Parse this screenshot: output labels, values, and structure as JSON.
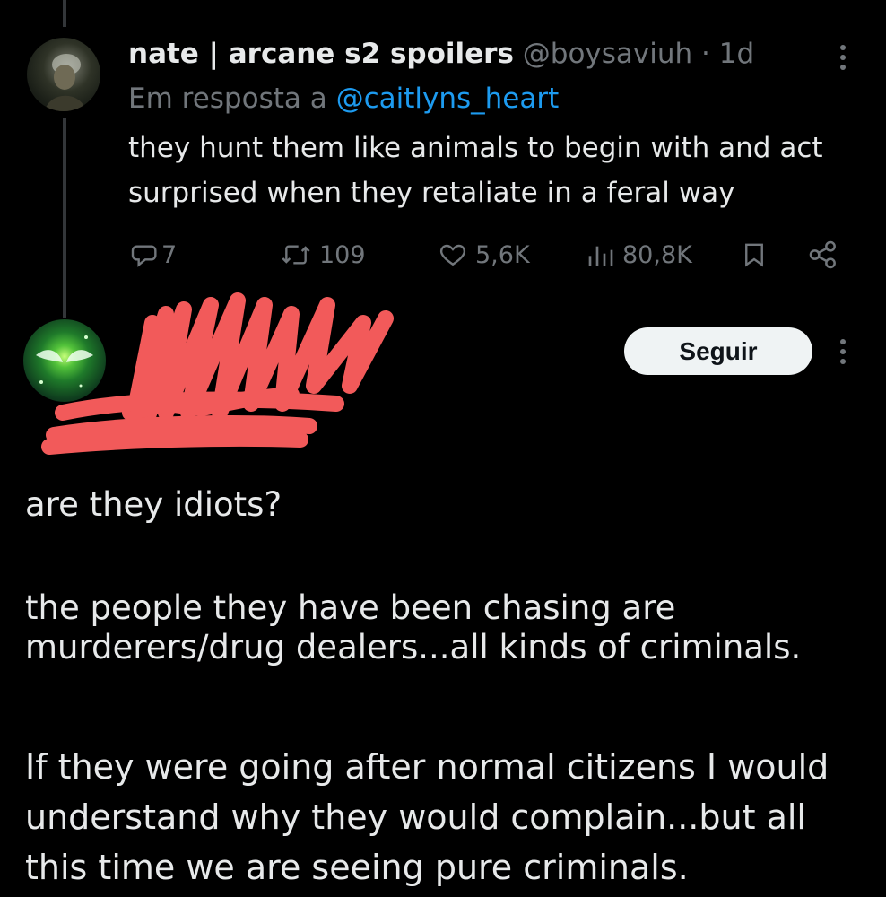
{
  "reply_tweet": {
    "display_name": "nate | arcane s2 spoilers",
    "handle": "@boysaviuh",
    "separator": " · ",
    "time": "1d",
    "reply_prefix": "Em resposta a ",
    "reply_to": "@caitlyns_heart",
    "text": "they hunt them like animals to begin with and act surprised when they retaliate in a feral way",
    "actions": {
      "replies": "7",
      "reposts": "109",
      "likes": "5,6K",
      "views": "80,8K"
    },
    "icons": [
      "reply-icon",
      "repost-icon",
      "like-icon",
      "views-icon",
      "bookmark-icon",
      "share-icon",
      "more-icon"
    ]
  },
  "main_tweet": {
    "follow_label": "Seguir",
    "paragraphs": [
      "are they idiots?",
      "the people they have been chasing are murderers/drug dealers...all kinds of criminals.",
      "If they were going after normal citizens I would understand why they would complain...but all this time we are seeing pure criminals."
    ]
  },
  "colors": {
    "background": "#000000",
    "text": "#e7e9ea",
    "muted": "#71767b",
    "link": "#1d9bf0",
    "redaction": "#f25a5a"
  }
}
